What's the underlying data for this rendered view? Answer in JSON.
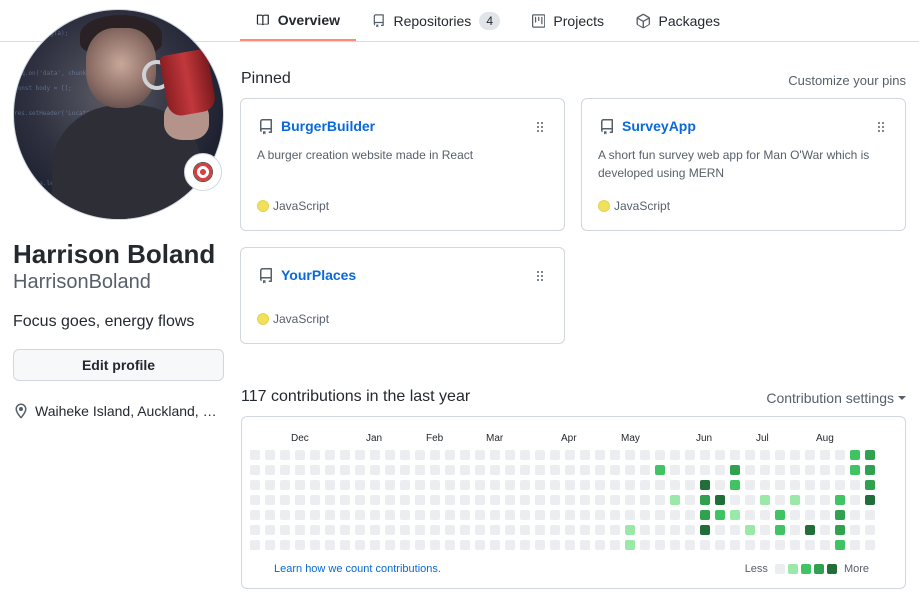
{
  "tabs": [
    {
      "label": "Overview",
      "icon": "book-icon",
      "selected": true
    },
    {
      "label": "Repositories",
      "icon": "repo-icon",
      "count": "4"
    },
    {
      "label": "Projects",
      "icon": "project-icon"
    },
    {
      "label": "Packages",
      "icon": "package-icon"
    }
  ],
  "profile": {
    "full_name": "Harrison Boland",
    "username": "HarrisonBoland",
    "bio": "Focus goes, energy flows",
    "edit_label": "Edit profile",
    "location": "Waiheke Island, Auckland, New Zealand",
    "status_icon": "direct-hit-icon"
  },
  "pinned": {
    "title": "Pinned",
    "customize_label": "Customize your pins",
    "repos": [
      {
        "name": "BurgerBuilder",
        "description": "A burger creation website made in React",
        "language": "JavaScript",
        "language_color": "#f1e05a"
      },
      {
        "name": "SurveyApp",
        "description": "A short fun survey web app for Man O'War which is developed using MERN",
        "language": "JavaScript",
        "language_color": "#f1e05a"
      },
      {
        "name": "YourPlaces",
        "description": "",
        "language": "JavaScript",
        "language_color": "#f1e05a"
      }
    ]
  },
  "contributions": {
    "title": "117 contributions in the last year",
    "settings_label": "Contribution settings",
    "months": [
      "Dec",
      "Jan",
      "Feb",
      "Mar",
      "Apr",
      "May",
      "Jun",
      "Jul",
      "Aug"
    ],
    "learn_link": "Learn how we count contributions.",
    "legend_less": "Less",
    "legend_more": "More",
    "colors": [
      "#ebedf0",
      "#9be9a8",
      "#40c463",
      "#30a14e",
      "#216e39"
    ],
    "levels": [
      [
        0,
        0,
        0,
        0,
        0,
        0,
        0
      ],
      [
        0,
        0,
        0,
        0,
        0,
        0,
        0
      ],
      [
        0,
        0,
        0,
        0,
        0,
        0,
        0
      ],
      [
        0,
        0,
        0,
        0,
        0,
        0,
        0
      ],
      [
        0,
        0,
        0,
        0,
        0,
        0,
        0
      ],
      [
        0,
        0,
        0,
        0,
        0,
        0,
        0
      ],
      [
        0,
        0,
        0,
        0,
        0,
        0,
        0
      ],
      [
        0,
        0,
        0,
        0,
        0,
        0,
        0
      ],
      [
        0,
        0,
        0,
        0,
        0,
        0,
        0
      ],
      [
        0,
        0,
        0,
        0,
        0,
        0,
        0
      ],
      [
        0,
        0,
        0,
        0,
        0,
        0,
        0
      ],
      [
        0,
        0,
        0,
        0,
        0,
        0,
        0
      ],
      [
        0,
        0,
        0,
        0,
        0,
        0,
        0
      ],
      [
        0,
        0,
        0,
        0,
        0,
        0,
        0
      ],
      [
        0,
        0,
        0,
        0,
        0,
        0,
        0
      ],
      [
        0,
        0,
        0,
        0,
        0,
        0,
        0
      ],
      [
        0,
        0,
        0,
        0,
        0,
        0,
        0
      ],
      [
        0,
        0,
        0,
        0,
        0,
        0,
        0
      ],
      [
        0,
        0,
        0,
        0,
        0,
        0,
        0
      ],
      [
        0,
        0,
        0,
        0,
        0,
        0,
        0
      ],
      [
        0,
        0,
        0,
        0,
        0,
        0,
        0
      ],
      [
        0,
        0,
        0,
        0,
        0,
        0,
        0
      ],
      [
        0,
        0,
        0,
        0,
        0,
        0,
        0
      ],
      [
        0,
        0,
        0,
        0,
        0,
        0,
        0
      ],
      [
        0,
        0,
        0,
        0,
        0,
        0,
        0
      ],
      [
        0,
        0,
        0,
        0,
        0,
        1,
        1
      ],
      [
        0,
        0,
        0,
        0,
        0,
        0,
        0
      ],
      [
        0,
        2,
        0,
        0,
        0,
        0,
        0
      ],
      [
        0,
        0,
        0,
        1,
        0,
        0,
        0
      ],
      [
        0,
        0,
        0,
        0,
        0,
        0,
        0
      ],
      [
        0,
        0,
        4,
        3,
        3,
        4,
        0
      ],
      [
        0,
        0,
        0,
        4,
        2,
        0,
        0
      ],
      [
        0,
        3,
        2,
        0,
        1,
        0,
        0
      ],
      [
        0,
        0,
        0,
        0,
        0,
        1,
        0
      ],
      [
        0,
        0,
        0,
        1,
        0,
        0,
        0
      ],
      [
        0,
        0,
        0,
        0,
        2,
        2,
        0
      ],
      [
        0,
        0,
        0,
        1,
        0,
        0,
        0
      ],
      [
        0,
        0,
        0,
        0,
        0,
        4,
        0
      ],
      [
        0,
        0,
        0,
        0,
        0,
        0,
        0
      ],
      [
        0,
        0,
        0,
        2,
        3,
        3,
        2
      ],
      [
        2,
        2,
        0,
        0,
        0,
        0,
        0
      ],
      [
        3,
        3,
        3,
        4,
        0,
        0,
        0
      ]
    ]
  }
}
